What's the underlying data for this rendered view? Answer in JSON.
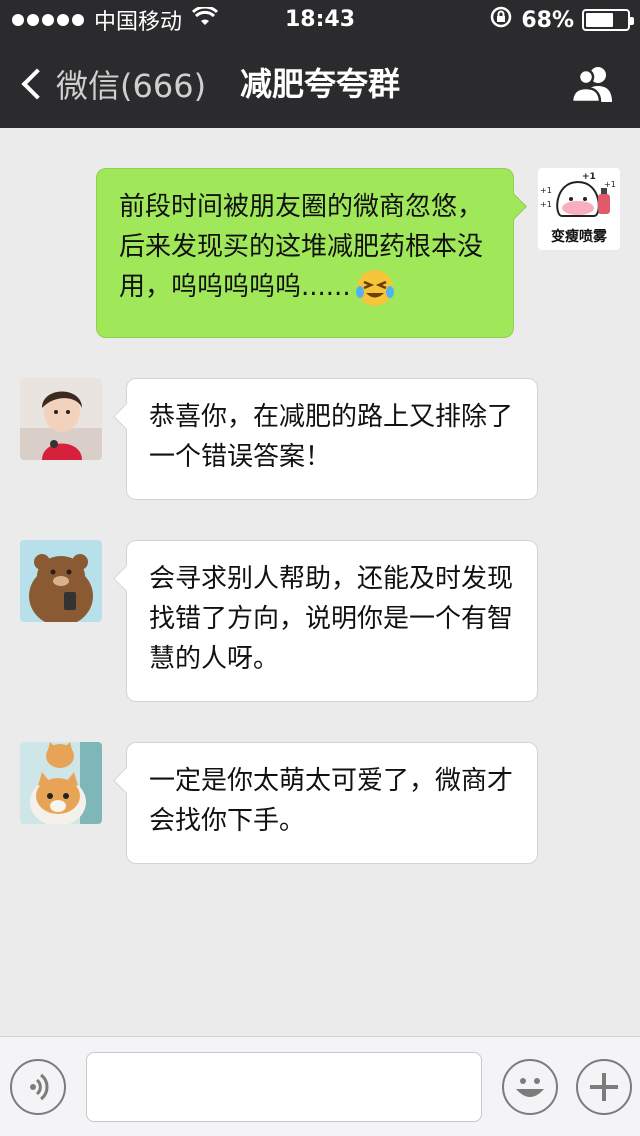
{
  "status_bar": {
    "carrier": "中国移动",
    "time": "18:43",
    "battery_percent": "68%",
    "battery_level": 0.68
  },
  "nav": {
    "back_label": "微信(666)",
    "title": "减肥夸夸群",
    "right_icon": "group-members-icon"
  },
  "messages": [
    {
      "side": "right",
      "text": "前段时间被朋友圈的微商忽悠，后来发现买的这堆减肥药根本没用，呜呜呜呜呜......",
      "emoji": "crying-laughing-face",
      "avatar_caption": "变瘦喷雾",
      "avatar_marks": [
        "+1",
        "+1",
        "+1",
        "+1"
      ]
    },
    {
      "side": "left",
      "text": "恭喜你，在减肥的路上又排除了一个错误答案！",
      "avatar": "girl-photo"
    },
    {
      "side": "left",
      "text": "会寻求别人帮助，还能及时发现找错了方向，说明你是一个有智慧的人呀。",
      "avatar": "bear-cartoon"
    },
    {
      "side": "left",
      "text": "一定是你太萌太可爱了，微商才会找你下手。",
      "avatar": "cats-photo"
    }
  ],
  "input_bar": {
    "voice_icon": "voice-icon",
    "text_value": "",
    "emoji_icon": "smiley-icon",
    "plus_icon": "plus-icon"
  },
  "colors": {
    "bar_dark": "#2b2b2d",
    "chat_bg": "#ebebeb",
    "self_bubble": "#a0e75a",
    "other_bubble": "#ffffff"
  }
}
